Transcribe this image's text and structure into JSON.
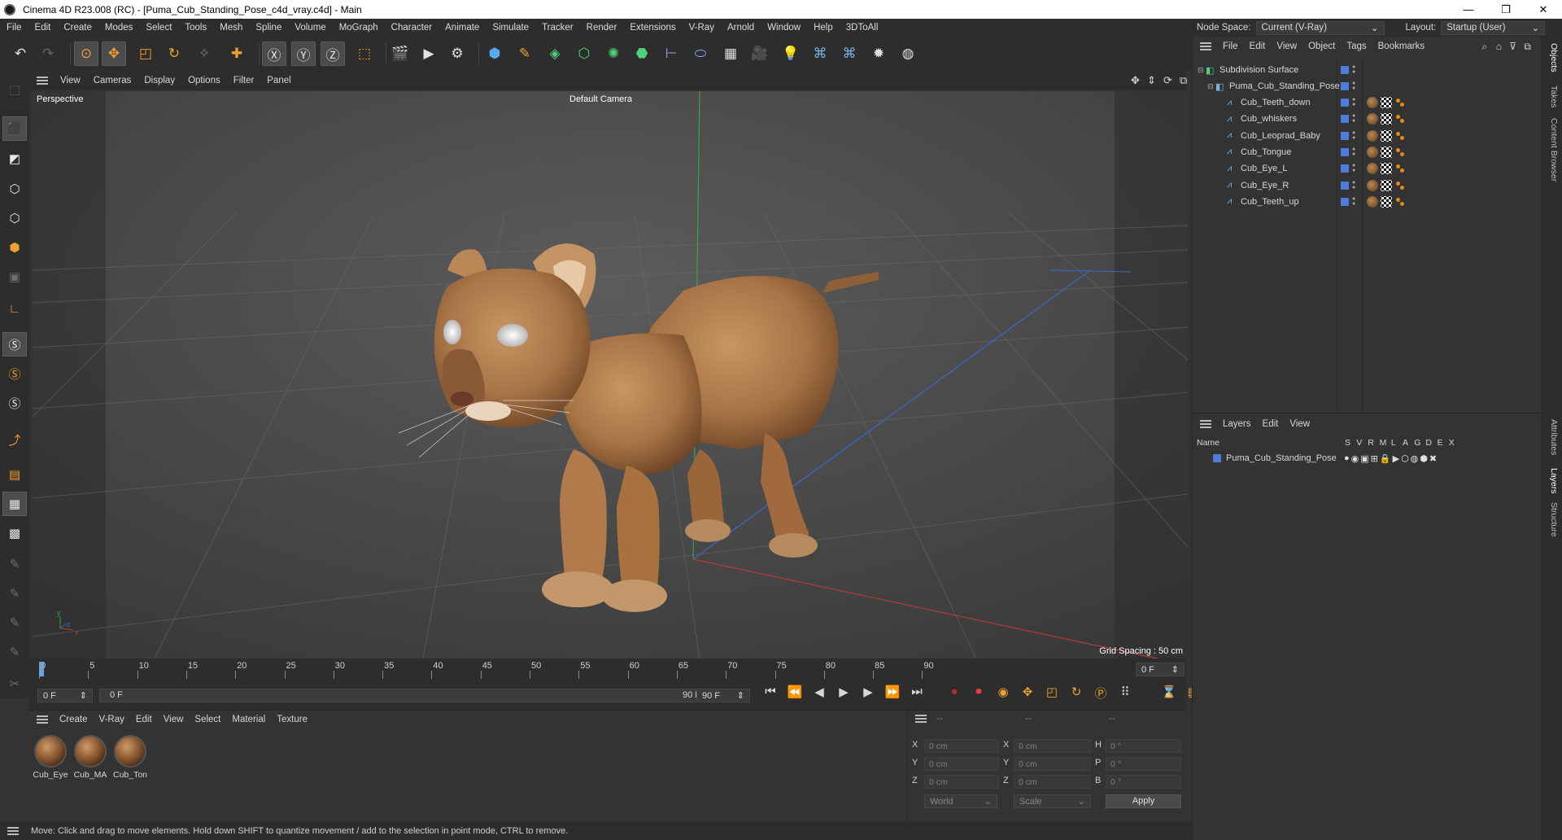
{
  "window": {
    "title": "Cinema 4D R23.008 (RC) - [Puma_Cub_Standing_Pose_c4d_vray.c4d] - Main",
    "controls": [
      "—",
      "❐",
      "✕"
    ]
  },
  "menubar": {
    "items": [
      "File",
      "Edit",
      "Create",
      "Modes",
      "Select",
      "Tools",
      "Mesh",
      "Spline",
      "Volume",
      "MoGraph",
      "Character",
      "Animate",
      "Simulate",
      "Tracker",
      "Render",
      "Extensions",
      "V-Ray",
      "Arnold",
      "Window",
      "Help",
      "3DToAll"
    ]
  },
  "nodespace": {
    "label": "Node Space:",
    "value": "Current (V-Ray)",
    "layout_label": "Layout:",
    "layout_value": "Startup (User)"
  },
  "viewport": {
    "menu": [
      "View",
      "Cameras",
      "Display",
      "Options",
      "Filter",
      "Panel"
    ],
    "label": "Perspective",
    "camera": "Default Camera",
    "grid_spacing": "Grid Spacing : 50 cm",
    "axis_y": "y",
    "axis_z": "z",
    "axis_x": "x"
  },
  "timeline": {
    "ticks": [
      "0",
      "5",
      "10",
      "15",
      "20",
      "25",
      "30",
      "35",
      "40",
      "45",
      "50",
      "55",
      "60",
      "65",
      "70",
      "75",
      "80",
      "85",
      "90"
    ],
    "current_frame": "0 F"
  },
  "anim": {
    "start": "0 F",
    "range_start": "0 F",
    "range_end": "90 F",
    "end": "90 F"
  },
  "materials": {
    "menu": [
      "Create",
      "V-Ray",
      "Edit",
      "View",
      "Select",
      "Material",
      "Texture"
    ],
    "items": [
      "Cub_Eye",
      "Cub_MA",
      "Cub_Ton"
    ]
  },
  "coords": {
    "header": [
      "--",
      "--",
      "--"
    ],
    "rows": [
      {
        "a": "X",
        "av": "0 cm",
        "b": "X",
        "bv": "0 cm",
        "c": "H",
        "cv": "0 °"
      },
      {
        "a": "Y",
        "av": "0 cm",
        "b": "Y",
        "bv": "0 cm",
        "c": "P",
        "cv": "0 °"
      },
      {
        "a": "Z",
        "av": "0 cm",
        "b": "Z",
        "bv": "0 cm",
        "c": "B",
        "cv": "0 °"
      }
    ],
    "mode": "World",
    "scale": "Scale",
    "apply": "Apply"
  },
  "objects": {
    "menu": [
      "File",
      "Edit",
      "View",
      "Object",
      "Tags",
      "Bookmarks"
    ],
    "root": "Subdivision Surface",
    "group": "Puma_Cub_Standing_Pose",
    "children": [
      "Cub_Teeth_down",
      "Cub_whiskers",
      "Cub_Leoprad_Baby",
      "Cub_Tongue",
      "Cub_Eye_L",
      "Cub_Eye_R",
      "Cub_Teeth_up"
    ]
  },
  "layers": {
    "menu": [
      "Layers",
      "Edit",
      "View"
    ],
    "col_name": "Name",
    "cols": [
      "S",
      "V",
      "R",
      "M",
      "L",
      "A",
      "G",
      "D",
      "E",
      "X"
    ],
    "items": [
      "Puma_Cub_Standing_Pose"
    ]
  },
  "sidetabs": [
    "Objects",
    "Takes",
    "Content Browser",
    "Attributes",
    "Layers",
    "Structure"
  ],
  "status": "Move: Click and drag to move elements. Hold down SHIFT to quantize movement / add to the selection in point mode, CTRL to remove.",
  "colors": {
    "accent": "#4f7bdc",
    "orange": "#e48a1a",
    "grid_x": "#b83a3a",
    "grid_y": "#2ea84a",
    "grid_z": "#3a6bc8"
  }
}
